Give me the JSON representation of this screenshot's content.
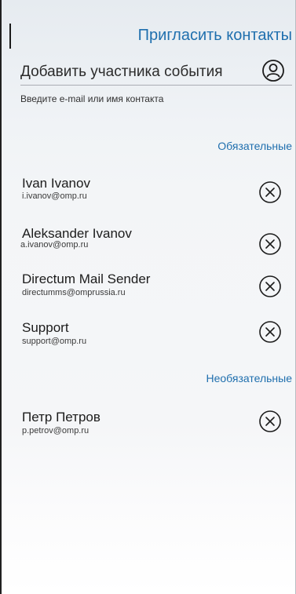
{
  "header": {
    "title": "Пригласить контакты"
  },
  "search": {
    "value": "Добавить участника события",
    "hint": "Введите e-mail или имя контакта"
  },
  "sections": {
    "required": "Обязательные",
    "optional": "Необязательные"
  },
  "required_contacts": [
    {
      "name": "Ivan Ivanov",
      "email": "i.ivanov@omp.ru"
    },
    {
      "name": "Aleksander Ivanov",
      "email": "a.ivanov@omp.ru"
    },
    {
      "name": "Directum Mail Sender",
      "email": "directumms@omprussia.ru"
    },
    {
      "name": "Support",
      "email": "support@omp.ru"
    }
  ],
  "optional_contacts": [
    {
      "name": "Петр Петров",
      "email": "p.petrov@omp.ru"
    }
  ],
  "icons": {
    "profile": "user-circle-icon",
    "remove": "close-circle-icon"
  },
  "colors": {
    "accent": "#1f6fae",
    "text": "#1c1c1c"
  }
}
